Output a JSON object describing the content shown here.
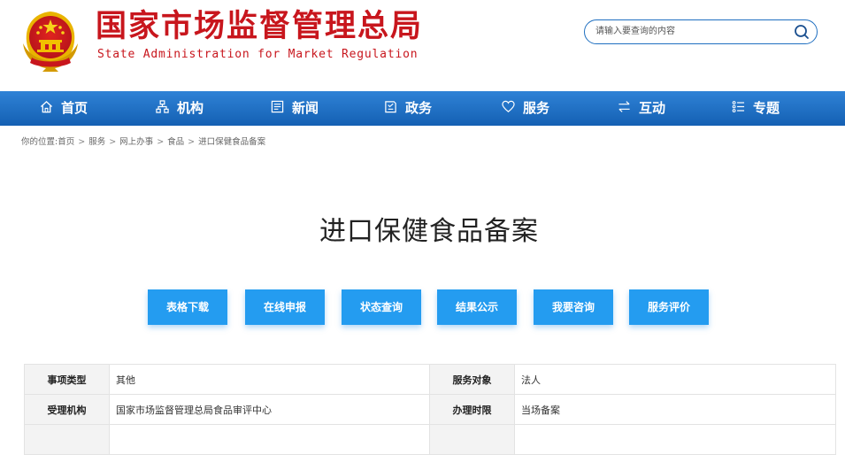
{
  "site": {
    "name_cn": "国家市场监督管理总局",
    "name_en": "State Administration for Market Regulation"
  },
  "search": {
    "placeholder": "请输入要查询的内容"
  },
  "nav": [
    {
      "label": "首页",
      "icon": "home-icon"
    },
    {
      "label": "机构",
      "icon": "org-chart-icon"
    },
    {
      "label": "新闻",
      "icon": "newspaper-icon"
    },
    {
      "label": "政务",
      "icon": "book-icon"
    },
    {
      "label": "服务",
      "icon": "heart-icon"
    },
    {
      "label": "互动",
      "icon": "exchange-arrows-icon"
    },
    {
      "label": "专题",
      "icon": "list-icon"
    }
  ],
  "breadcrumb": {
    "prefix": "你的位置:",
    "items": [
      "首页",
      "服务",
      "网上办事",
      "食品",
      "进口保健食品备案"
    ],
    "separator": ">"
  },
  "page": {
    "title": "进口保健食品备案"
  },
  "actions": [
    "表格下载",
    "在线申报",
    "状态查询",
    "结果公示",
    "我要咨询",
    "服务评价"
  ],
  "info": {
    "rows": [
      [
        {
          "label": "事项类型",
          "value": "其他"
        },
        {
          "label": "服务对象",
          "value": "法人"
        }
      ],
      [
        {
          "label": "受理机构",
          "value": "国家市场监督管理总局食品审评中心"
        },
        {
          "label": "办理时限",
          "value": "当场备案"
        }
      ]
    ]
  },
  "colors": {
    "brand_red": "#c8161d",
    "nav_blue": "#1f6fc0",
    "button_blue": "#249cf0",
    "emblem_gold": "#f2c000"
  }
}
